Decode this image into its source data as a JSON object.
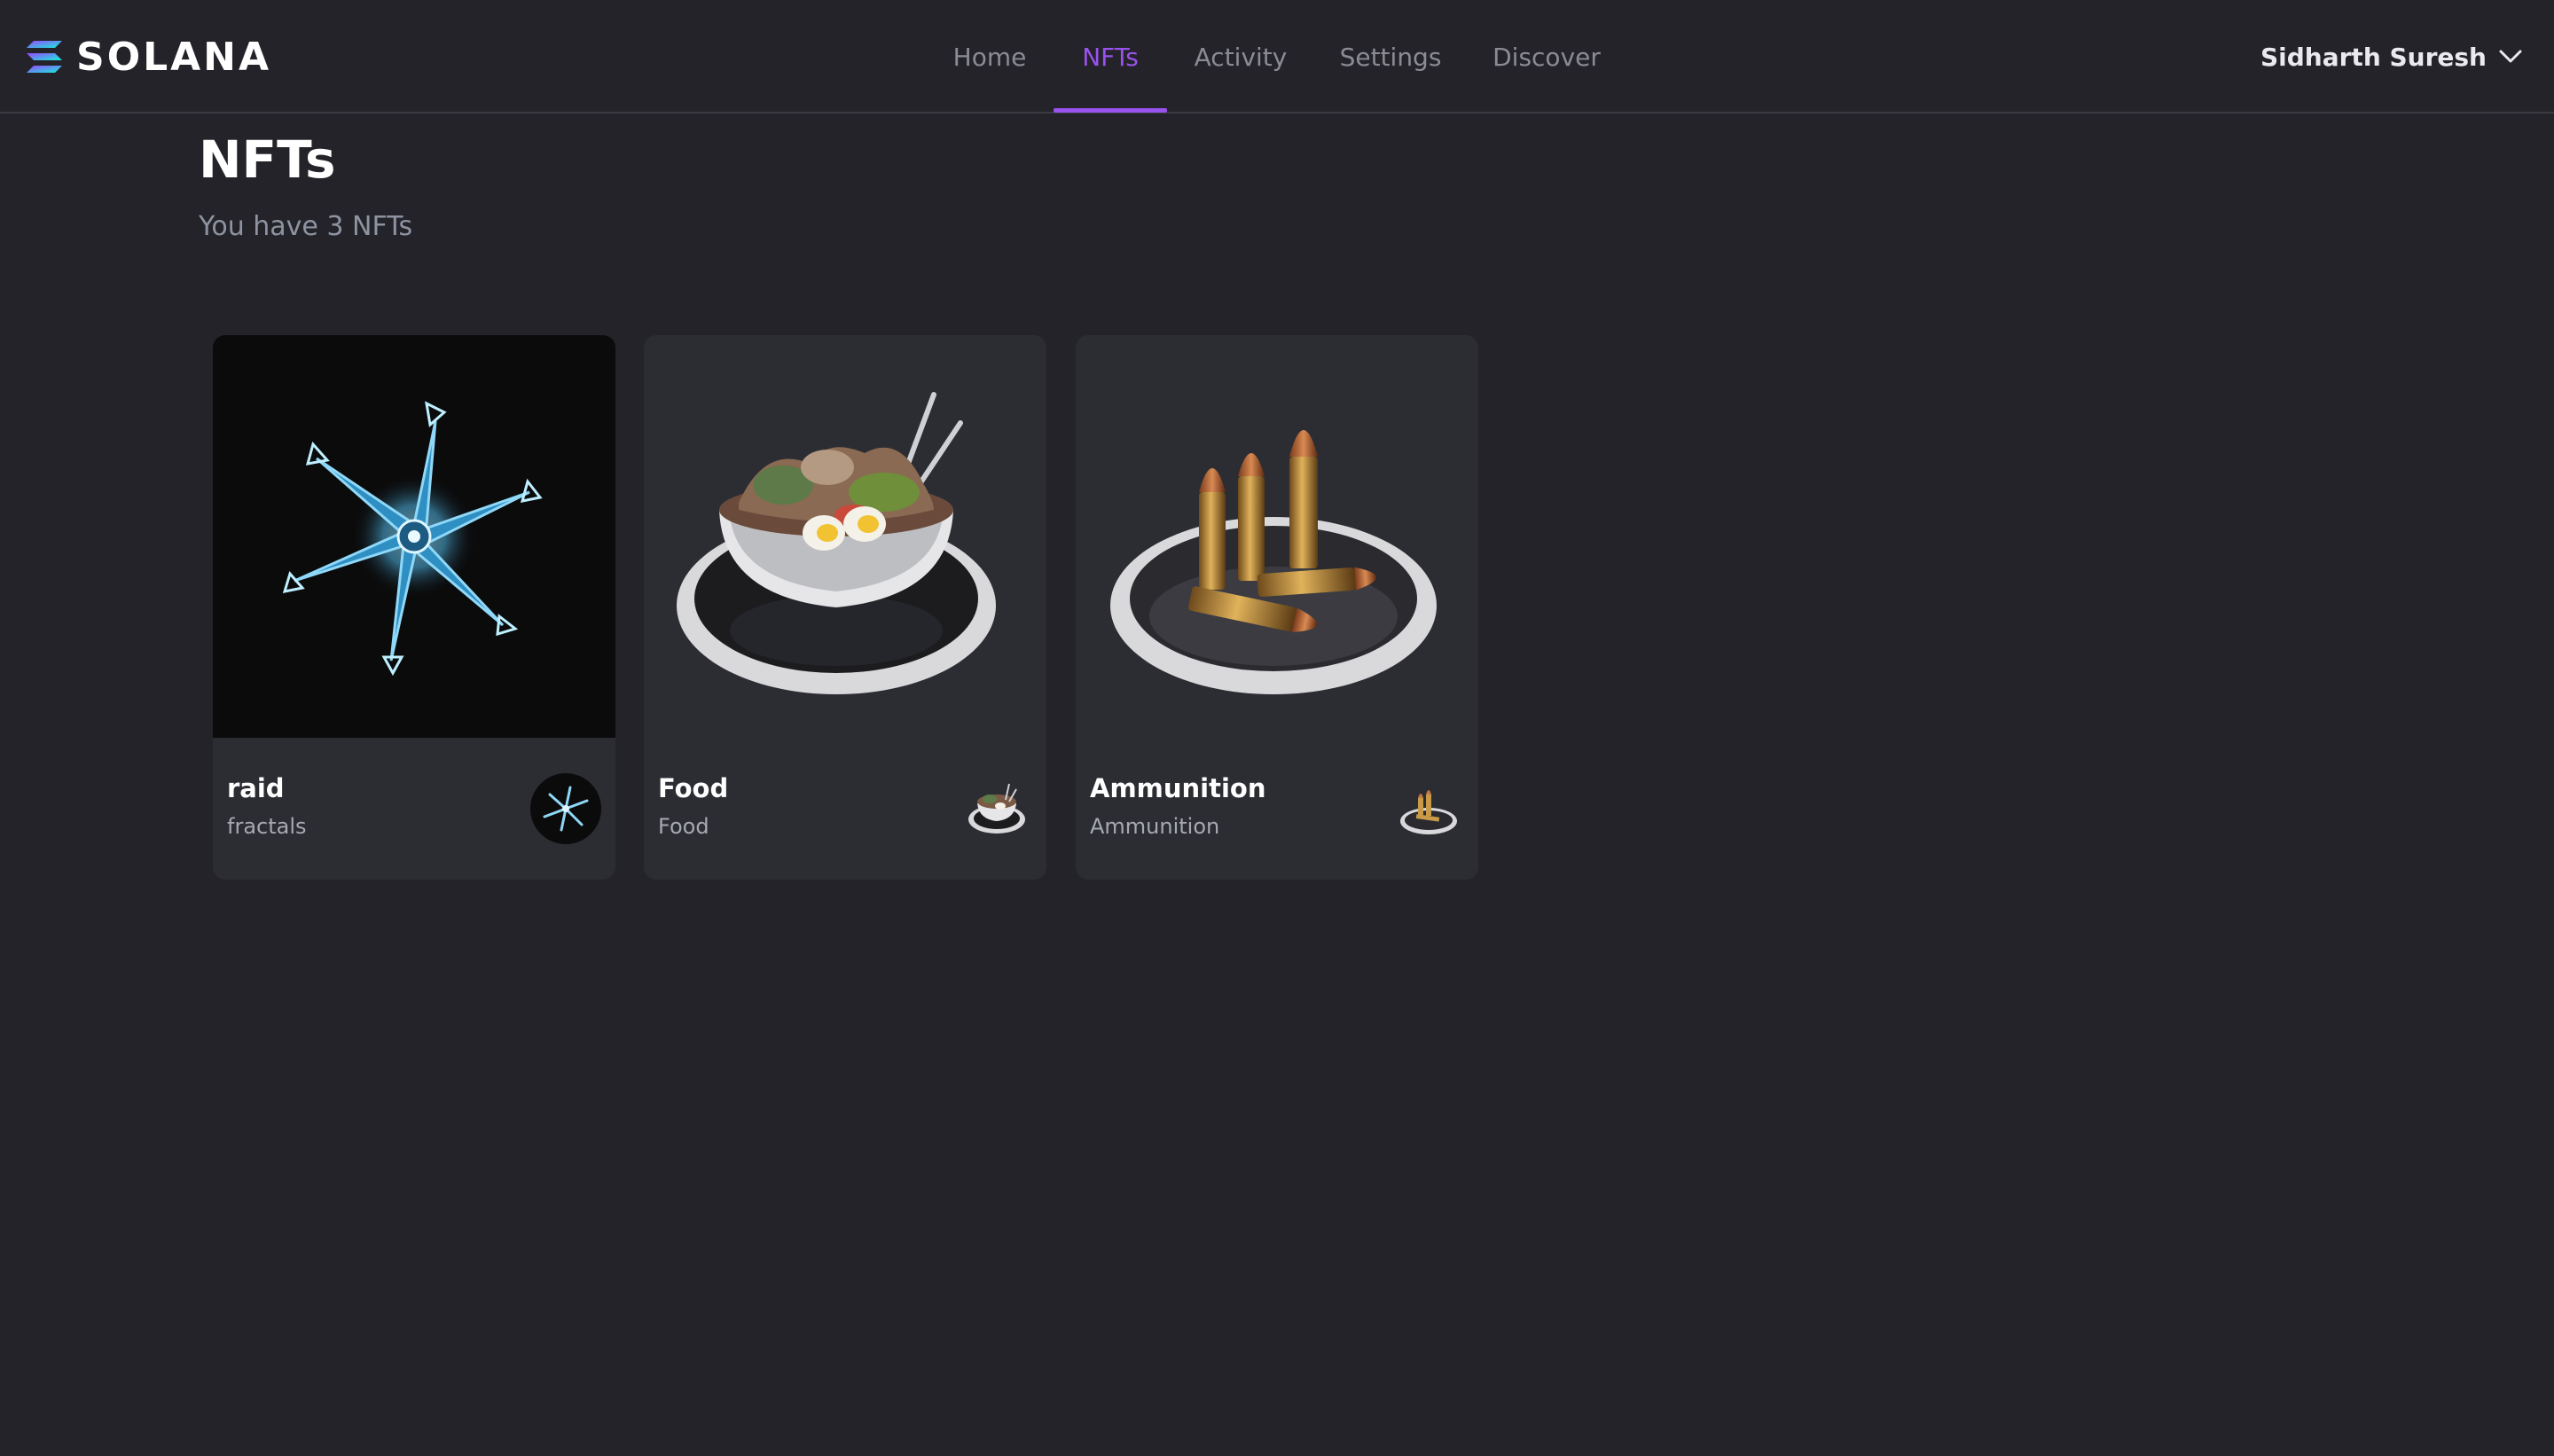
{
  "brand": {
    "name": "SOLANA",
    "icon": "solana-logo-icon"
  },
  "nav": {
    "items": [
      {
        "label": "Home",
        "active": false
      },
      {
        "label": "NFTs",
        "active": true
      },
      {
        "label": "Activity",
        "active": false
      },
      {
        "label": "Settings",
        "active": false
      },
      {
        "label": "Discover",
        "active": false
      }
    ]
  },
  "user": {
    "name": "Sidharth Suresh",
    "icon": "chevron-down-icon"
  },
  "page": {
    "title": "NFTs",
    "subtitle": "You have 3 NFTs"
  },
  "nfts": [
    {
      "name": "raid",
      "collection": "fractals",
      "image": "blue-fractal-star-image"
    },
    {
      "name": "Food",
      "collection": "Food",
      "image": "food-bowl-image"
    },
    {
      "name": "Ammunition",
      "collection": "Ammunition",
      "image": "bullets-on-plate-image"
    }
  ],
  "colors": {
    "background": "#232329",
    "card": "#2c2d33",
    "accent": "#9a52ee",
    "nav_inactive": "#8b8b94",
    "subtitle": "#8e93a1"
  }
}
